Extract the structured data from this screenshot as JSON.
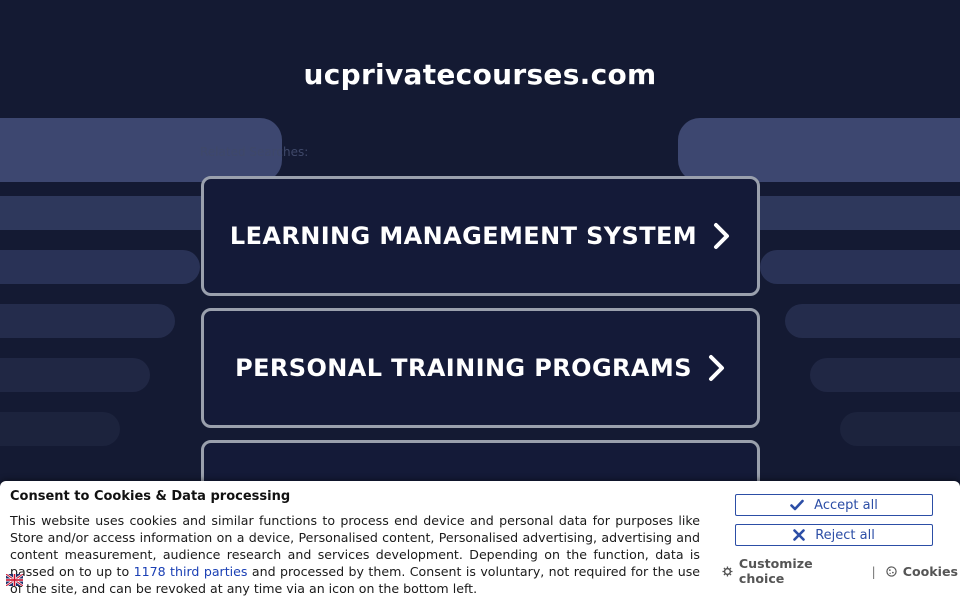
{
  "header": {
    "site_title": "ucprivatecourses.com"
  },
  "related_searches_label": "Related Searches:",
  "search_links": [
    {
      "label": "LEARNING MANAGEMENT SYSTEM"
    },
    {
      "label": "PERSONAL TRAINING PROGRAMS"
    },
    {
      "label": ""
    }
  ],
  "cookie_banner": {
    "title": "Consent to Cookies & Data processing",
    "text_before_link": "This website uses cookies and similar functions to process end device and personal data for purposes like Store and/or access information on a device, Personalised content, Personalised advertising, advertising and content measurement, audience research and services development. Depending on the function, data is passed on to up to ",
    "link_text": "1178 third parties",
    "text_after_link": " and processed by them. Consent is voluntary, not required for the use of the site, and can be revoked at any time via an icon on the bottom left.",
    "accept_label": "Accept all",
    "reject_label": "Reject all",
    "customize_label": "Customize choice",
    "separator": "|",
    "cookies_label": "Cookies",
    "link_color": "#1a3fb4",
    "button_color": "#2c4ea6"
  },
  "colors": {
    "background": "#141a33",
    "band": "#26304f",
    "link_border": "#9aa0ad"
  },
  "icons": {
    "link_chevron": "chevron-right-icon",
    "accept": "check-icon",
    "reject": "x-icon",
    "customize": "gear-icon",
    "cookies": "cookie-icon",
    "language": "flag-icon"
  }
}
